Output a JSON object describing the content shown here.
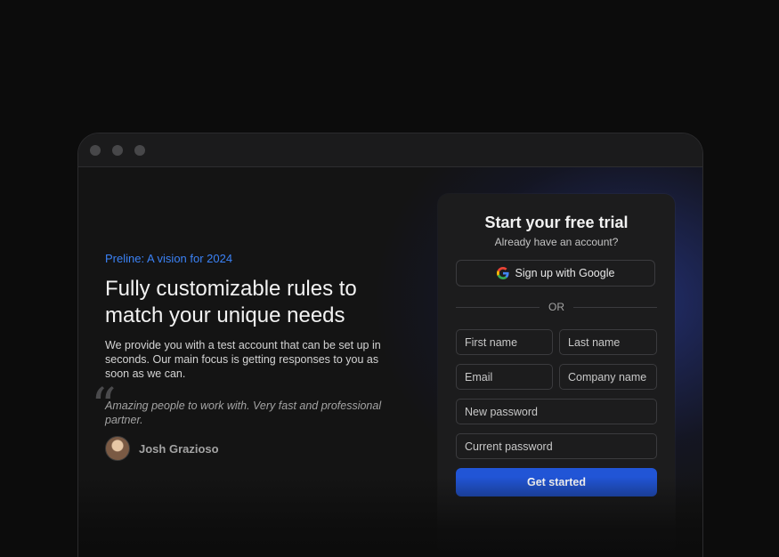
{
  "window": {
    "controls": [
      "close",
      "minimize",
      "maximize"
    ]
  },
  "hero": {
    "eyebrow": "Preline: A vision for 2024",
    "headline_line1": "Fully customizable rules to",
    "headline_line2": "match your unique needs",
    "description": "We provide you with a test account that can be set up in seconds. Our main focus is getting responses to you as soon as we can.",
    "quote": "Amazing people to work with. Very fast and professional partner.",
    "author": "Josh Grazioso"
  },
  "signup": {
    "title": "Start your free trial",
    "subtitle": "Already have an account?",
    "google_label": "Sign up with Google",
    "divider": "OR",
    "fields": {
      "first_name": "First name",
      "last_name": "Last name",
      "email": "Email",
      "company": "Company name",
      "new_password": "New password",
      "current_password": "Current password"
    },
    "submit_label": "Get started"
  },
  "colors": {
    "accent": "#3b82f6",
    "button": "#2155d6",
    "background": "#0c0c0c"
  },
  "icons": {
    "quote": "quote-icon",
    "google": "google-icon"
  }
}
